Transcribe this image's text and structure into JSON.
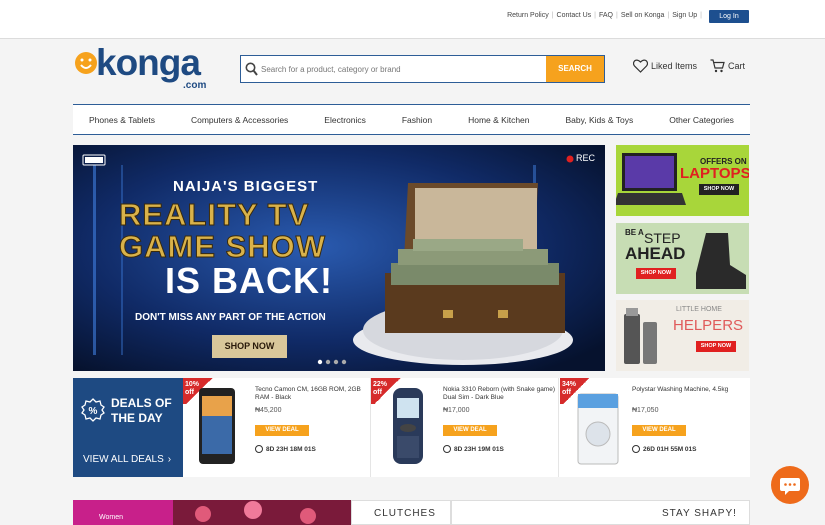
{
  "toplinks": {
    "items": [
      "Return Policy",
      "Contact Us",
      "FAQ",
      "Sell on Konga",
      "Sign Up"
    ],
    "login": "Log In"
  },
  "header": {
    "logo_text": "konga",
    "logo_suffix": ".com",
    "search_placeholder": "Search for a product, category or brand",
    "search_button": "SEARCH",
    "liked_items": "Liked Items",
    "cart": "Cart"
  },
  "nav": {
    "items": [
      "Phones & Tablets",
      "Computers & Accessories",
      "Electronics",
      "Fashion",
      "Home & Kitchen",
      "Baby, Kids & Toys",
      "Other Categories"
    ]
  },
  "hero": {
    "rec": "REC",
    "line1": "NAIJA'S BIGGEST",
    "line2": "REALITY TV",
    "line3": "GAME SHOW",
    "line4": "IS BACK!",
    "subline": "DON'T MISS ANY PART OF THE ACTION",
    "cta": "SHOP NOW",
    "slide_count": 4,
    "active_slide": 1
  },
  "side_banners": {
    "laptops": {
      "top": "OFFERS ON",
      "main": "LAPTOPS",
      "cta": "SHOP NOW"
    },
    "shoes": {
      "line1": "BE A",
      "line2": "STEP",
      "line3": "AHEAD",
      "cta": "SHOP NOW"
    },
    "helpers": {
      "line1": "LITTLE HOME",
      "line2": "HELPERS",
      "cta": "SHOP NOW"
    }
  },
  "deals": {
    "title_line1": "DEALS OF",
    "title_line2": "THE DAY",
    "view_all": "VIEW ALL DEALS",
    "items": [
      {
        "badge": "10%",
        "off": "off",
        "name": "Tecno Camon CM, 16GB ROM, 2GB RAM - Black",
        "price": "₦45,200",
        "cta": "VIEW DEAL",
        "timer": "8D 23H 18M 01S"
      },
      {
        "badge": "22%",
        "off": "off",
        "name": "Nokia 3310 Reborn (with Snake game) Dual Sim - Dark Blue",
        "price": "₦17,000",
        "cta": "VIEW DEAL",
        "timer": "8D 23H 19M 01S"
      },
      {
        "badge": "34%",
        "off": "off",
        "name": "Polystar Washing Machine, 4.5kg",
        "price": "₦17,050",
        "cta": "VIEW DEAL",
        "timer": "26D 01H 55M 01S"
      }
    ]
  },
  "bottom": {
    "women": "Women",
    "clutches": "CLUTCHES",
    "stay_shapy": "STAY SHAPY!"
  },
  "colors": {
    "brand_blue": "#1e4a82",
    "brand_orange": "#f6a21d",
    "deal_red": "#d62b2b",
    "chat_orange": "#ee6a1a"
  }
}
